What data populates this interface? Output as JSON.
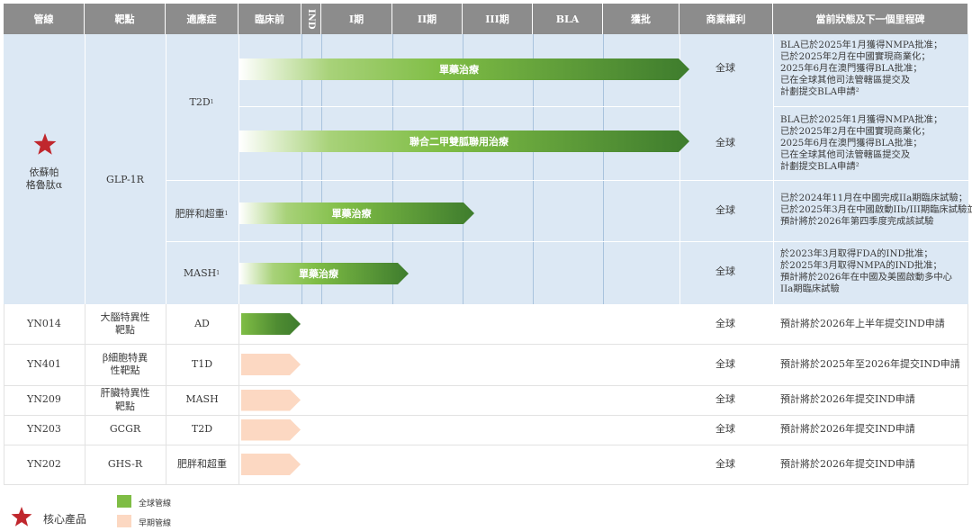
{
  "headers": [
    "管線",
    "靶點",
    "適應症",
    "臨床前",
    "IND",
    "I期",
    "II期",
    "III期",
    "BLA",
    "獲批",
    "商業權利",
    "當前狀態及下一個里程碑"
  ],
  "core_product": {
    "name": "依蘇帕\n格魯肽α",
    "target": "GLP-1R",
    "indications": [
      {
        "label": "T2D",
        "sup": "1",
        "sub_rows": [
          {
            "bar_label": "單藥治療",
            "rights": "全球",
            "milestone": [
              "BLA已於2025年1月獲得NMPA批准；",
              "已於2025年2月在中國實現商業化；",
              "2025年6月在澳門獲得BLA批准；",
              "已在全球其他司法管轄區提交及",
              "計劃提交BLA申請²"
            ]
          },
          {
            "bar_label": "聯合二甲雙胍聯用治療",
            "rights": "全球",
            "milestone": [
              "BLA已於2025年1月獲得NMPA批准；",
              "已於2025年2月在中國實現商業化；",
              "2025年6月在澳門獲得BLA批准；",
              "已在全球其他司法管轄區提交及",
              "計劃提交BLA申請²"
            ]
          }
        ]
      },
      {
        "label": "肥胖和超重",
        "sup": "1",
        "sub_rows": [
          {
            "bar_label": "單藥治療",
            "rights": "全球",
            "milestone": [
              "已於2024年11月在中國完成IIa期臨床試驗；",
              "已於2025年3月在中國啟動IIb/III期臨床試驗並",
              "預計將於2026年第四季度完成該試驗"
            ]
          }
        ]
      },
      {
        "label": "MASH",
        "sup": "1",
        "sub_rows": [
          {
            "bar_label": "單藥治療",
            "rights": "全球",
            "milestone": [
              "於2023年3月取得FDA的IND批准；",
              "於2025年3月取得NMPA的IND批准；",
              "預計將於2026年在中國及美國啟動多中心",
              "IIa期臨床試驗"
            ]
          }
        ]
      }
    ]
  },
  "other_rows": [
    {
      "name": "YN014",
      "target": "大腦特異性\n靶點",
      "indication": "AD",
      "rights": "全球",
      "milestone": "預計將於2026年上半年提交IND申請",
      "kind": "global"
    },
    {
      "name": "YN401",
      "target": "β細胞特異\n性靶點",
      "indication": "T1D",
      "rights": "全球",
      "milestone": "預計將於2025年至2026年提交IND申請",
      "kind": "early"
    },
    {
      "name": "YN209",
      "target": "肝臟特異性\n靶點",
      "indication": "MASH",
      "rights": "全球",
      "milestone": "預計將於2026年提交IND申請",
      "kind": "early"
    },
    {
      "name": "YN203",
      "target": "GCGR",
      "indication": "T2D",
      "rights": "全球",
      "milestone": "預計將於2026年提交IND申請",
      "kind": "early"
    },
    {
      "name": "YN202",
      "target": "GHS-R",
      "indication": "肥胖和超重",
      "rights": "全球",
      "milestone": "預計將於2026年提交IND申請",
      "kind": "early"
    }
  ],
  "legend": {
    "core": "核心產品",
    "global": "全球管線",
    "early": "早期管線"
  },
  "colors": {
    "header": "#8c8c8c",
    "band": "#dce8f4",
    "global_green": "#7fbd45",
    "global_dark": "#3e7c2d",
    "early": "#fcd8c2",
    "star": "#c0272d"
  }
}
